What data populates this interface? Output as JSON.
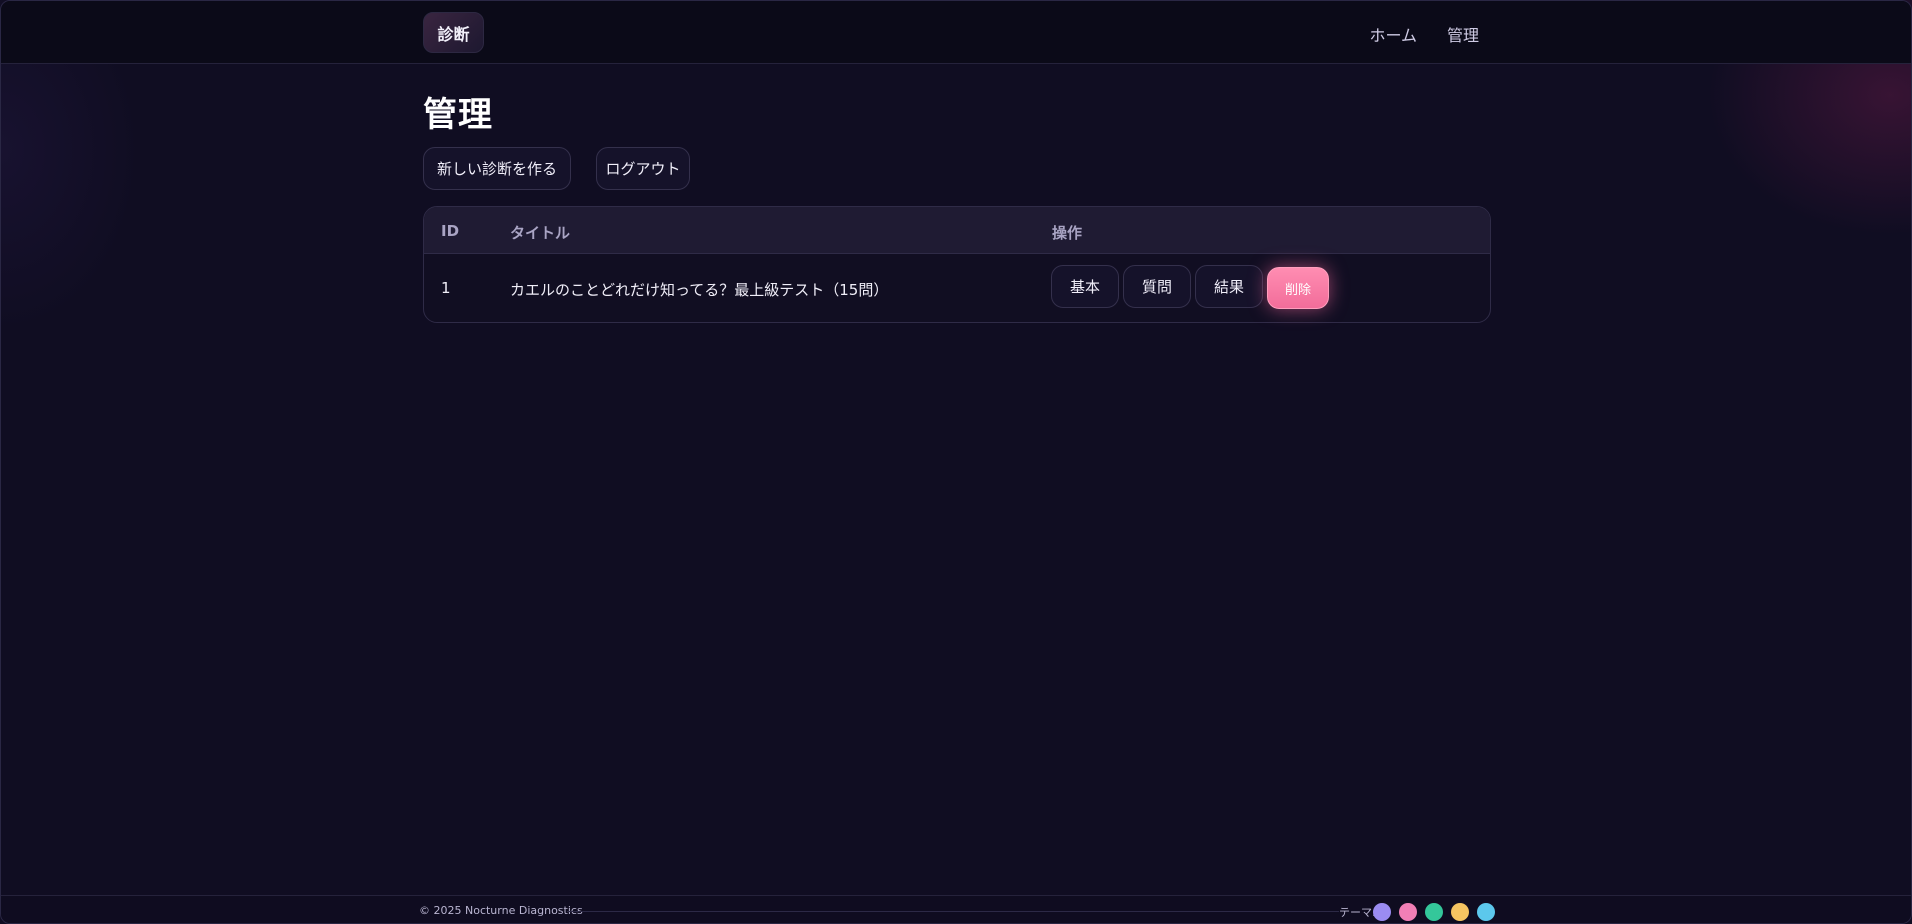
{
  "header": {
    "brand": "診断",
    "nav": [
      {
        "label": "ホーム"
      },
      {
        "label": "管理"
      }
    ]
  },
  "main": {
    "title": "管理",
    "actions": {
      "new_label": "新しい診断を作る",
      "logout_label": "ログアウト"
    },
    "table": {
      "columns": [
        "ID",
        "タイトル",
        "操作"
      ],
      "rows": [
        {
          "id": "1",
          "title": "カエルのことどれだけ知ってる？最上級テスト（15問）",
          "actions": {
            "basic": "基本",
            "questions": "質問",
            "results": "結果",
            "delete": "削除"
          }
        }
      ]
    }
  },
  "footer": {
    "copyright": "© 2025 Nocturne Diagnostics",
    "theme_label": "テーマ:",
    "themes": [
      {
        "name": "purple",
        "color": "#9b8cf2"
      },
      {
        "name": "pink",
        "color": "#f27fb6"
      },
      {
        "name": "green",
        "color": "#34c79a"
      },
      {
        "name": "yellow",
        "color": "#f5c461"
      },
      {
        "name": "blue",
        "color": "#5cc8ec"
      }
    ]
  },
  "colors": {
    "background": "#100d22",
    "accent_delete": "#f26d9a"
  }
}
